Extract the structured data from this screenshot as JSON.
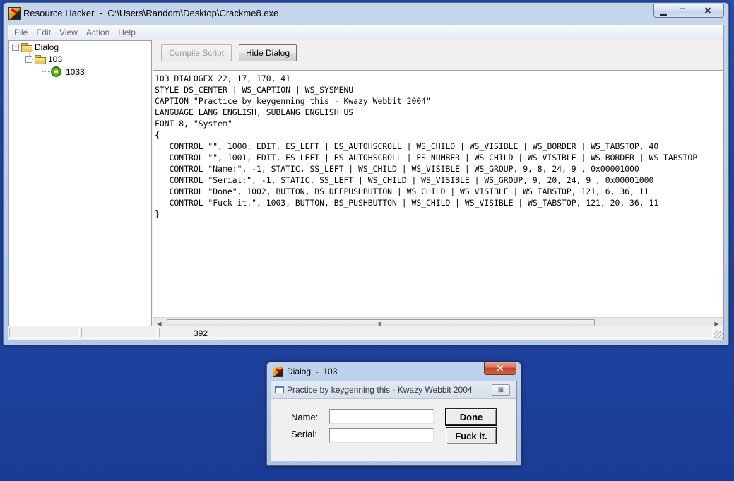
{
  "main_window": {
    "app_name": "Resource Hacker",
    "separator": "  -  ",
    "file_path": "C:\\Users\\Random\\Desktop\\Crackme8.exe",
    "controls": {
      "minimize": "▁",
      "maximize": "□",
      "close": "✕"
    }
  },
  "menu": [
    "File",
    "Edit",
    "View",
    "Action",
    "Help"
  ],
  "tree": {
    "root": "Dialog",
    "child": "103",
    "leaf": "1033",
    "expander_symbol": "−"
  },
  "toolbar": {
    "compile_label": "Compile Script",
    "hide_label": "Hide Dialog"
  },
  "script_text": "103 DIALOGEX 22, 17, 170, 41\nSTYLE DS_CENTER | WS_CAPTION | WS_SYSMENU\nCAPTION \"Practice by keygenning this - Kwazy Webbit 2004\"\nLANGUAGE LANG_ENGLISH, SUBLANG_ENGLISH_US\nFONT 8, \"System\"\n{\n   CONTROL \"\", 1000, EDIT, ES_LEFT | ES_AUTOHSCROLL | WS_CHILD | WS_VISIBLE | WS_BORDER | WS_TABSTOP, 40\n   CONTROL \"\", 1001, EDIT, ES_LEFT | ES_AUTOHSCROLL | ES_NUMBER | WS_CHILD | WS_VISIBLE | WS_BORDER | WS_TABSTOP\n   CONTROL \"Name:\", -1, STATIC, SS_LEFT | WS_CHILD | WS_VISIBLE | WS_GROUP, 9, 8, 24, 9 , 0x00001000\n   CONTROL \"Serial:\", -1, STATIC, SS_LEFT | WS_CHILD | WS_VISIBLE | WS_GROUP, 9, 20, 24, 9 , 0x00001000\n   CONTROL \"Done\", 1002, BUTTON, BS_DEFPUSHBUTTON | WS_CHILD | WS_VISIBLE | WS_TABSTOP, 121, 6, 36, 11\n   CONTROL \"Fuck it.\", 1003, BUTTON, BS_PUSHBUTTON | WS_CHILD | WS_VISIBLE | WS_TABSTOP, 121, 20, 36, 11\n}",
  "scrollbar": {
    "left_arrow": "◀",
    "right_arrow": "▶",
    "grip": "III"
  },
  "status": {
    "value": "392"
  },
  "dialog": {
    "window_title": "Dialog  -  103",
    "close_symbol": "✕",
    "caption": "Practice by keygenning this - Kwazy Webbit 2004",
    "inner_close_symbol": "⊠",
    "name_label": "Name:",
    "serial_label": "Serial:",
    "name_value": "",
    "serial_value": "",
    "done_label": "Done",
    "fuckit_label": "Fuck it."
  }
}
